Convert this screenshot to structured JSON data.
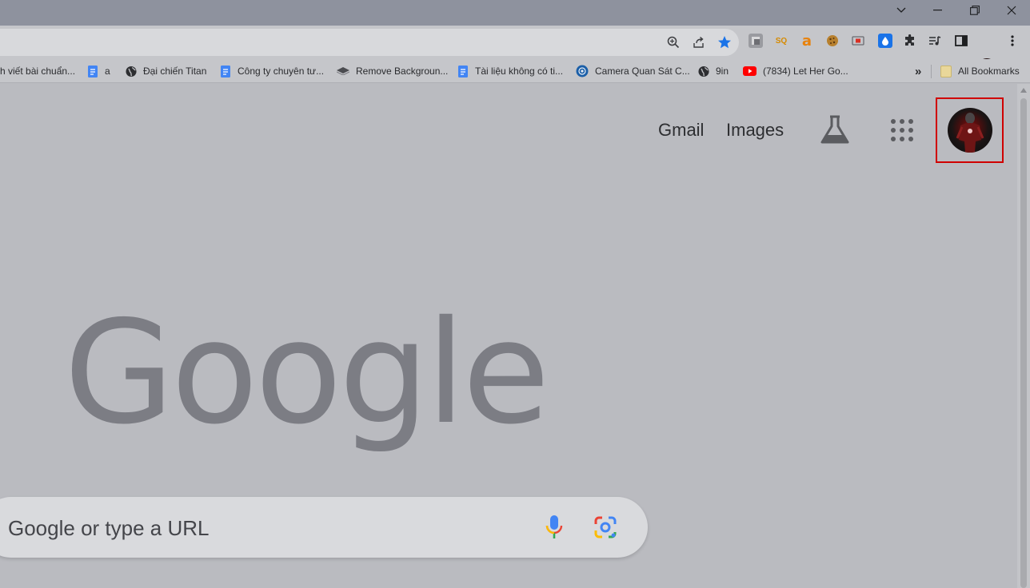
{
  "bookmarks": {
    "items": [
      {
        "label": "h viết bài chuẩn...",
        "icon": "none"
      },
      {
        "label": "a",
        "icon": "docs-icon"
      },
      {
        "label": "Đại chiến Titan",
        "icon": "globe-icon"
      },
      {
        "label": "Công ty chuyên tư...",
        "icon": "docs-icon"
      },
      {
        "label": "Remove Backgroun...",
        "icon": "removebg-icon"
      },
      {
        "label": "Tài liệu không có ti...",
        "icon": "docs-icon"
      },
      {
        "label": "Camera Quan Sát C...",
        "icon": "camera-site-icon"
      },
      {
        "label": "9in",
        "icon": "globe-icon"
      },
      {
        "label": "(7834) Let Her Go...",
        "icon": "youtube-icon"
      }
    ],
    "overflow_label": "»",
    "all_bookmarks_label": "All Bookmarks"
  },
  "toolbar": {
    "badge_count": "0"
  },
  "header": {
    "gmail_label": "Gmail",
    "images_label": "Images"
  },
  "logo": {
    "text": "Google"
  },
  "search": {
    "placeholder": "Google or type a URL"
  },
  "colors": {
    "highlight_border": "#d00000",
    "star": "#1a73e8",
    "youtube": "#ff0000",
    "docs": "#4285f4"
  }
}
